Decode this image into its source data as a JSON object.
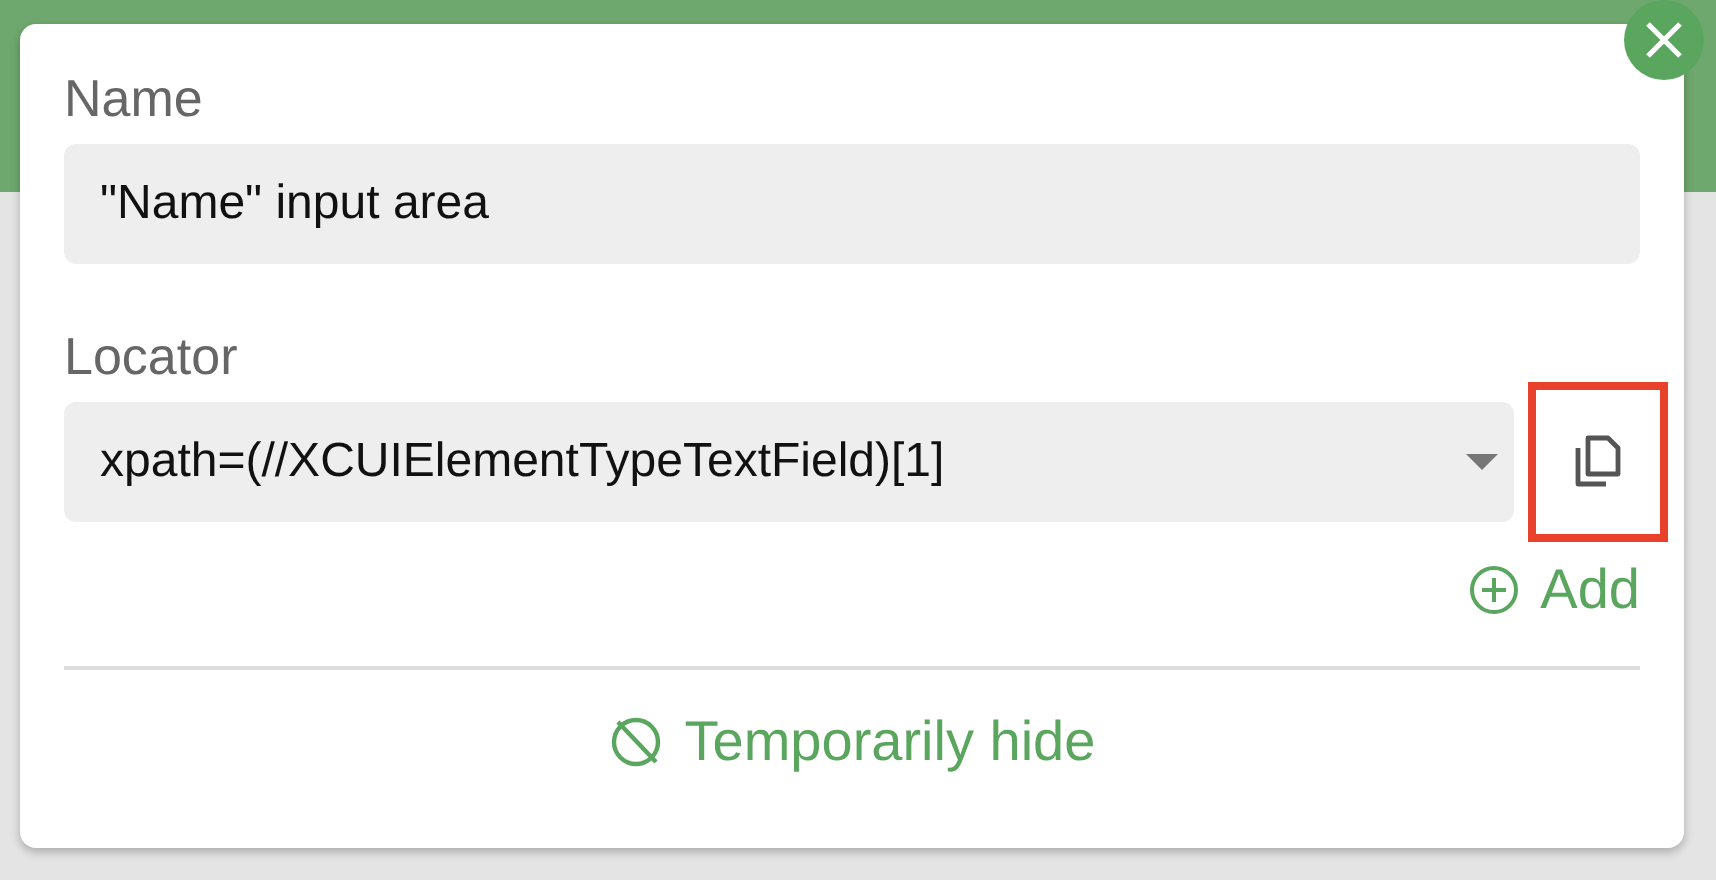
{
  "name_field": {
    "label": "Name",
    "value": "\"Name\" input area"
  },
  "locator_field": {
    "label": "Locator",
    "value": "xpath=(//XCUIElementTypeTextField)[1]",
    "copy_highlighted": true
  },
  "add_button": {
    "label": "Add"
  },
  "hide_button": {
    "label": "Temporarily hide"
  }
}
